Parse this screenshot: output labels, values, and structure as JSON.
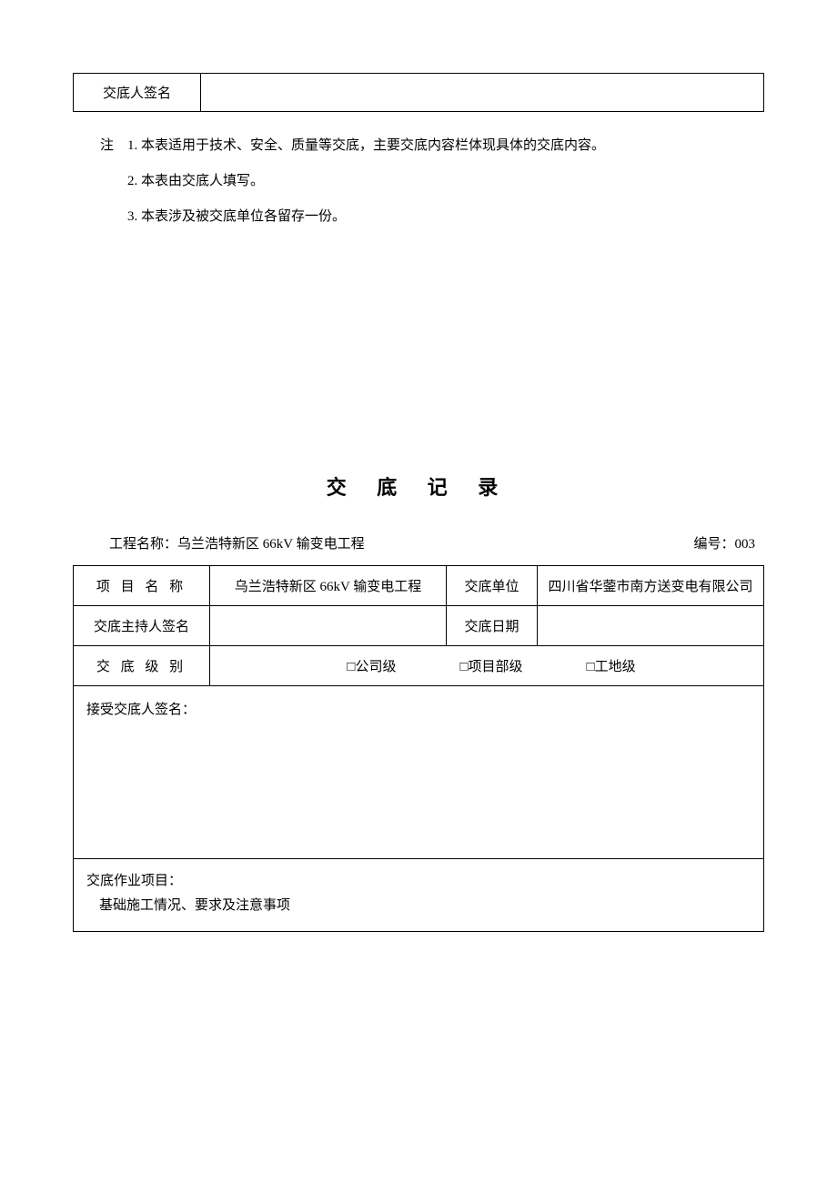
{
  "top_table": {
    "label": "交底人签名",
    "value": ""
  },
  "notes": {
    "prefix": "注",
    "items": [
      "1. 本表适用于技术、安全、质量等交底，主要交底内容栏体现具体的交底内容。",
      "2. 本表由交底人填写。",
      "3. 本表涉及被交底单位各留存一份。"
    ]
  },
  "title": "交 底 记 录",
  "meta": {
    "project_label": "工程名称：",
    "project_value": "乌兰浩特新区 66kV 输变电工程",
    "serial_label": "编号：",
    "serial_value": "003"
  },
  "form": {
    "row1": {
      "label": "项 目 名 称",
      "value": "乌兰浩特新区 66kV 输变电工程",
      "unit_label": "交底单位",
      "unit_value": "四川省华蓥市南方送变电有限公司"
    },
    "row2": {
      "host_label": "交底主持人签名",
      "host_value": "",
      "date_label": "交底日期",
      "date_value": ""
    },
    "row3": {
      "level_label": "交 底 级 别",
      "options": [
        "□公司级",
        "□项目部级",
        "□工地级"
      ]
    },
    "row4": {
      "sign_label": "接受交底人签名："
    },
    "row5": {
      "work_label": "交底作业项目：",
      "work_sub": "基础施工情况、要求及注意事项"
    }
  }
}
